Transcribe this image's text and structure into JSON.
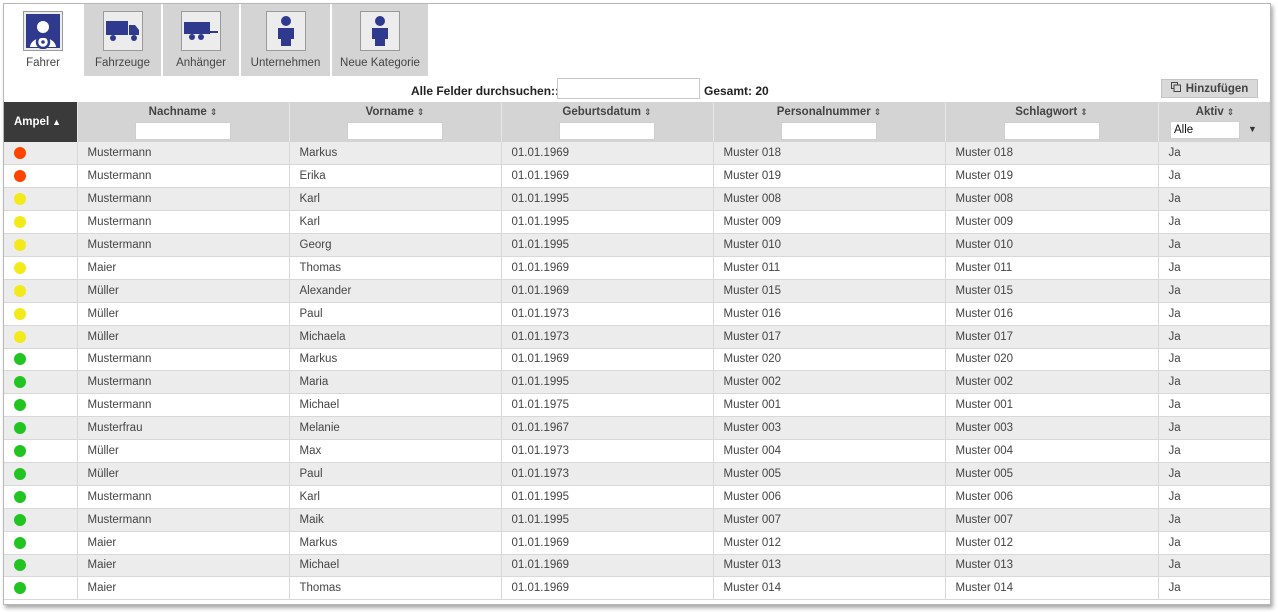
{
  "tabs": [
    {
      "label": "Fahrer",
      "icon": "driver-icon",
      "active": true
    },
    {
      "label": "Fahrzeuge",
      "icon": "truck-icon",
      "active": false
    },
    {
      "label": "Anhänger",
      "icon": "trailer-icon",
      "active": false
    },
    {
      "label": "Unternehmen",
      "icon": "person-icon",
      "active": false
    },
    {
      "label": "Neue Kategorie",
      "icon": "person-icon",
      "active": false
    }
  ],
  "search": {
    "label": "Alle Felder durchsuchen::",
    "value": "",
    "total": "Gesamt: 20"
  },
  "add_button": {
    "label": "Hinzufügen",
    "icon": "copy-icon"
  },
  "columns": [
    {
      "key": "ampel",
      "label": "Ampel",
      "sort": "asc"
    },
    {
      "key": "nachname",
      "label": "Nachname",
      "sort": "none"
    },
    {
      "key": "vorname",
      "label": "Vorname",
      "sort": "none"
    },
    {
      "key": "geburtsdatum",
      "label": "Geburtsdatum",
      "sort": "none"
    },
    {
      "key": "personalnummer",
      "label": "Personalnummer",
      "sort": "none"
    },
    {
      "key": "schlagwort",
      "label": "Schlagwort",
      "sort": "none"
    },
    {
      "key": "aktiv",
      "label": "Aktiv",
      "sort": "none"
    }
  ],
  "aktiv_filter": {
    "selected": "Alle"
  },
  "status_colors": {
    "red": "#ff4400",
    "yellow": "#f2ea1a",
    "green": "#22c422"
  },
  "rows": [
    {
      "status": "red",
      "nachname": "Mustermann",
      "vorname": "Markus",
      "geburtsdatum": "01.01.1969",
      "personalnummer": "Muster 018",
      "schlagwort": "Muster 018",
      "aktiv": "Ja"
    },
    {
      "status": "red",
      "nachname": "Mustermann",
      "vorname": "Erika",
      "geburtsdatum": "01.01.1969",
      "personalnummer": "Muster 019",
      "schlagwort": "Muster 019",
      "aktiv": "Ja"
    },
    {
      "status": "yellow",
      "nachname": "Mustermann",
      "vorname": "Karl",
      "geburtsdatum": "01.01.1995",
      "personalnummer": "Muster 008",
      "schlagwort": "Muster 008",
      "aktiv": "Ja"
    },
    {
      "status": "yellow",
      "nachname": "Mustermann",
      "vorname": "Karl",
      "geburtsdatum": "01.01.1995",
      "personalnummer": "Muster 009",
      "schlagwort": "Muster 009",
      "aktiv": "Ja"
    },
    {
      "status": "yellow",
      "nachname": "Mustermann",
      "vorname": "Georg",
      "geburtsdatum": "01.01.1995",
      "personalnummer": "Muster 010",
      "schlagwort": "Muster 010",
      "aktiv": "Ja"
    },
    {
      "status": "yellow",
      "nachname": "Maier",
      "vorname": "Thomas",
      "geburtsdatum": "01.01.1969",
      "personalnummer": "Muster 011",
      "schlagwort": "Muster 011",
      "aktiv": "Ja"
    },
    {
      "status": "yellow",
      "nachname": "Müller",
      "vorname": "Alexander",
      "geburtsdatum": "01.01.1969",
      "personalnummer": "Muster 015",
      "schlagwort": "Muster 015",
      "aktiv": "Ja"
    },
    {
      "status": "yellow",
      "nachname": "Müller",
      "vorname": "Paul",
      "geburtsdatum": "01.01.1973",
      "personalnummer": "Muster 016",
      "schlagwort": "Muster 016",
      "aktiv": "Ja"
    },
    {
      "status": "yellow",
      "nachname": "Müller",
      "vorname": "Michaela",
      "geburtsdatum": "01.01.1973",
      "personalnummer": "Muster 017",
      "schlagwort": "Muster 017",
      "aktiv": "Ja"
    },
    {
      "status": "green",
      "nachname": "Mustermann",
      "vorname": "Markus",
      "geburtsdatum": "01.01.1969",
      "personalnummer": "Muster 020",
      "schlagwort": "Muster 020",
      "aktiv": "Ja"
    },
    {
      "status": "green",
      "nachname": "Mustermann",
      "vorname": "Maria",
      "geburtsdatum": "01.01.1995",
      "personalnummer": "Muster 002",
      "schlagwort": "Muster 002",
      "aktiv": "Ja"
    },
    {
      "status": "green",
      "nachname": "Mustermann",
      "vorname": "Michael",
      "geburtsdatum": "01.01.1975",
      "personalnummer": "Muster 001",
      "schlagwort": "Muster 001",
      "aktiv": "Ja"
    },
    {
      "status": "green",
      "nachname": "Musterfrau",
      "vorname": "Melanie",
      "geburtsdatum": "01.01.1967",
      "personalnummer": "Muster 003",
      "schlagwort": "Muster 003",
      "aktiv": "Ja"
    },
    {
      "status": "green",
      "nachname": "Müller",
      "vorname": "Max",
      "geburtsdatum": "01.01.1973",
      "personalnummer": "Muster 004",
      "schlagwort": "Muster 004",
      "aktiv": "Ja"
    },
    {
      "status": "green",
      "nachname": "Müller",
      "vorname": "Paul",
      "geburtsdatum": "01.01.1973",
      "personalnummer": "Muster 005",
      "schlagwort": "Muster 005",
      "aktiv": "Ja"
    },
    {
      "status": "green",
      "nachname": "Mustermann",
      "vorname": "Karl",
      "geburtsdatum": "01.01.1995",
      "personalnummer": "Muster 006",
      "schlagwort": "Muster 006",
      "aktiv": "Ja"
    },
    {
      "status": "green",
      "nachname": "Mustermann",
      "vorname": "Maik",
      "geburtsdatum": "01.01.1995",
      "personalnummer": "Muster 007",
      "schlagwort": "Muster 007",
      "aktiv": "Ja"
    },
    {
      "status": "green",
      "nachname": "Maier",
      "vorname": "Markus",
      "geburtsdatum": "01.01.1969",
      "personalnummer": "Muster 012",
      "schlagwort": "Muster 012",
      "aktiv": "Ja"
    },
    {
      "status": "green",
      "nachname": "Maier",
      "vorname": "Michael",
      "geburtsdatum": "01.01.1969",
      "personalnummer": "Muster 013",
      "schlagwort": "Muster 013",
      "aktiv": "Ja"
    },
    {
      "status": "green",
      "nachname": "Maier",
      "vorname": "Thomas",
      "geburtsdatum": "01.01.1969",
      "personalnummer": "Muster 014",
      "schlagwort": "Muster 014",
      "aktiv": "Ja"
    }
  ]
}
